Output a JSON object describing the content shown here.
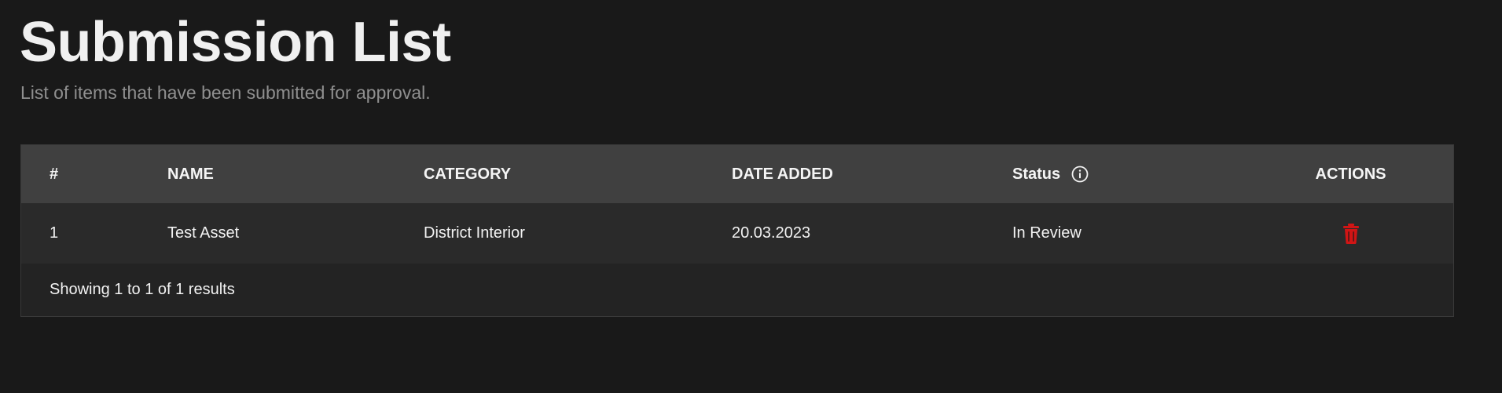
{
  "header": {
    "title": "Submission List",
    "subtitle": "List of items that have been submitted for approval."
  },
  "table": {
    "columns": {
      "index": "#",
      "name": "NAME",
      "category": "CATEGORY",
      "date_added": "DATE ADDED",
      "status": "Status",
      "actions": "ACTIONS"
    },
    "rows": [
      {
        "index": "1",
        "name": "Test Asset",
        "category": "District Interior",
        "date_added": "20.03.2023",
        "status": "In Review",
        "action_icon": "trash-icon"
      }
    ],
    "footer": "Showing 1 to 1 of 1 results"
  },
  "colors": {
    "background": "#191919",
    "header_row": "#404040",
    "data_row": "#2a2a2a",
    "delete_red": "#d11515",
    "subtitle_gray": "#8f8f8f"
  },
  "icons": {
    "status_info": "info-icon",
    "delete": "trash-icon"
  }
}
